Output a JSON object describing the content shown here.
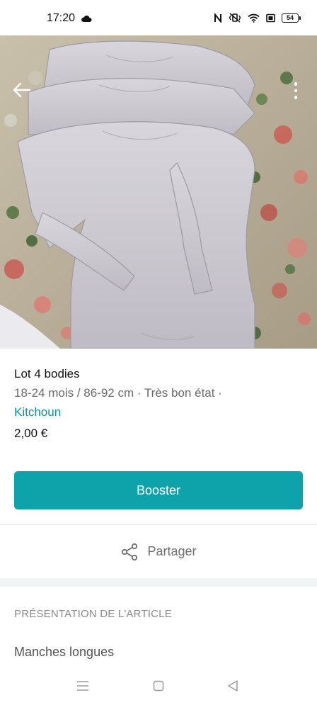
{
  "status_bar": {
    "time": "17:20",
    "battery": "54",
    "icons": [
      "cloud-icon",
      "nfc-icon",
      "vibrate-icon",
      "wifi-icon",
      "screen-icon",
      "battery-icon"
    ]
  },
  "photo": {
    "subject": "",
    "back_icon": "arrow-left-icon",
    "menu_icon": "more-vertical-icon"
  },
  "item": {
    "title": "Lot 4 bodies",
    "meta": "18-24 mois / 86-92 cm · Très bon état ·",
    "brand": "Kitchoun",
    "price": "2,00 €"
  },
  "actions": {
    "booster_label": "Booster",
    "share_label": "Partager"
  },
  "description": {
    "heading": "PRÉSENTATION DE L'ARTICLE",
    "first_line": "Manches longues"
  },
  "colors": {
    "accent": "#0ea2ab",
    "brand_text": "#0b8f98"
  }
}
